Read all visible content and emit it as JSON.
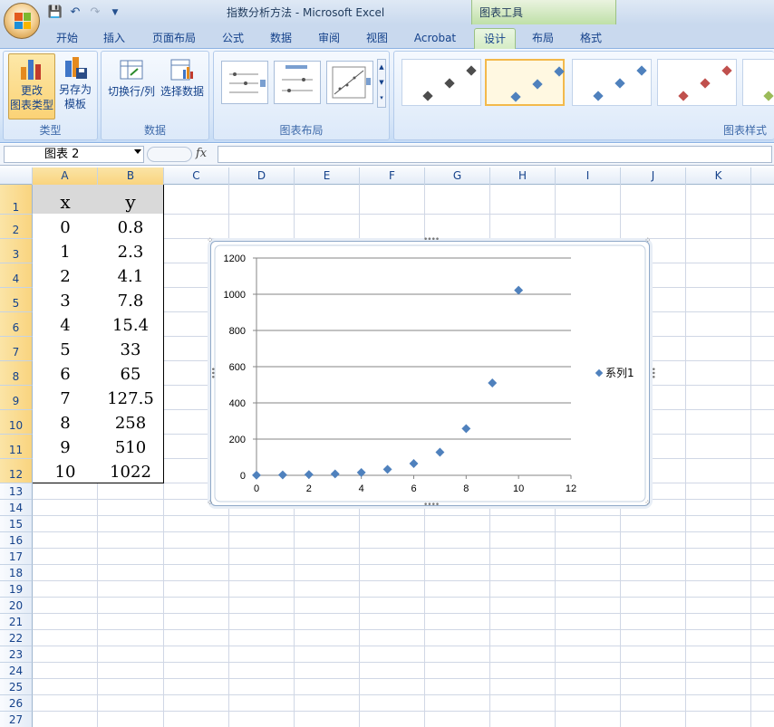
{
  "window": {
    "title": "指数分析方法 - Microsoft Excel",
    "context_tab_group": "图表工具"
  },
  "qat": {
    "save_icon": "save-icon",
    "undo_icon": "undo-icon",
    "redo_icon": "redo-icon",
    "customize_icon": "chevron-down-icon"
  },
  "tabs": [
    "开始",
    "插入",
    "页面布局",
    "公式",
    "数据",
    "审阅",
    "视图",
    "Acrobat",
    "设计",
    "布局",
    "格式"
  ],
  "active_tab": "设计",
  "ribbon": {
    "type_group": {
      "label": "类型",
      "change_type": "更改\n图表类型",
      "save_template": "另存为\n模板"
    },
    "data_group": {
      "label": "数据",
      "switch_row_col": "切换行/列",
      "select_data": "选择数据"
    },
    "layout_group": {
      "label": "图表布局"
    },
    "style_group": {
      "label": "图表样式"
    }
  },
  "formula_bar": {
    "name_box": "图表 2",
    "fx": "fx",
    "content": ""
  },
  "columns": [
    "A",
    "B",
    "C",
    "D",
    "E",
    "F",
    "G",
    "H",
    "I",
    "J",
    "K"
  ],
  "rows": [
    "1",
    "2",
    "3",
    "4",
    "5",
    "6",
    "7",
    "8",
    "9",
    "10",
    "11",
    "12",
    "13",
    "14",
    "15",
    "16",
    "17",
    "18",
    "19",
    "20",
    "21",
    "22",
    "23",
    "24",
    "25",
    "26",
    "27"
  ],
  "table": {
    "headers": [
      "x",
      "y"
    ],
    "rows": [
      [
        "0",
        "0.8"
      ],
      [
        "1",
        "2.3"
      ],
      [
        "2",
        "4.1"
      ],
      [
        "3",
        "7.8"
      ],
      [
        "4",
        "15.4"
      ],
      [
        "5",
        "33"
      ],
      [
        "6",
        "65"
      ],
      [
        "7",
        "127.5"
      ],
      [
        "8",
        "258"
      ],
      [
        "9",
        "510"
      ],
      [
        "10",
        "1022"
      ]
    ]
  },
  "colors": {
    "series": "#4f81bd",
    "style_dark": "#4d4d4d",
    "style_red": "#c0504d",
    "style_green": "#9bbb59"
  },
  "chart_data": {
    "type": "scatter",
    "series": [
      {
        "name": "系列1",
        "x": [
          0,
          1,
          2,
          3,
          4,
          5,
          6,
          7,
          8,
          9,
          10
        ],
        "y": [
          0.8,
          2.3,
          4.1,
          7.8,
          15.4,
          33,
          65,
          127.5,
          258,
          510,
          1022
        ]
      }
    ],
    "xlim": [
      0,
      12
    ],
    "ylim": [
      0,
      1200
    ],
    "x_ticks": [
      "0",
      "2",
      "4",
      "6",
      "8",
      "10",
      "12"
    ],
    "y_ticks": [
      "0",
      "200",
      "400",
      "600",
      "800",
      "1000",
      "1200"
    ],
    "grid": "horizontal",
    "legend": "right"
  }
}
